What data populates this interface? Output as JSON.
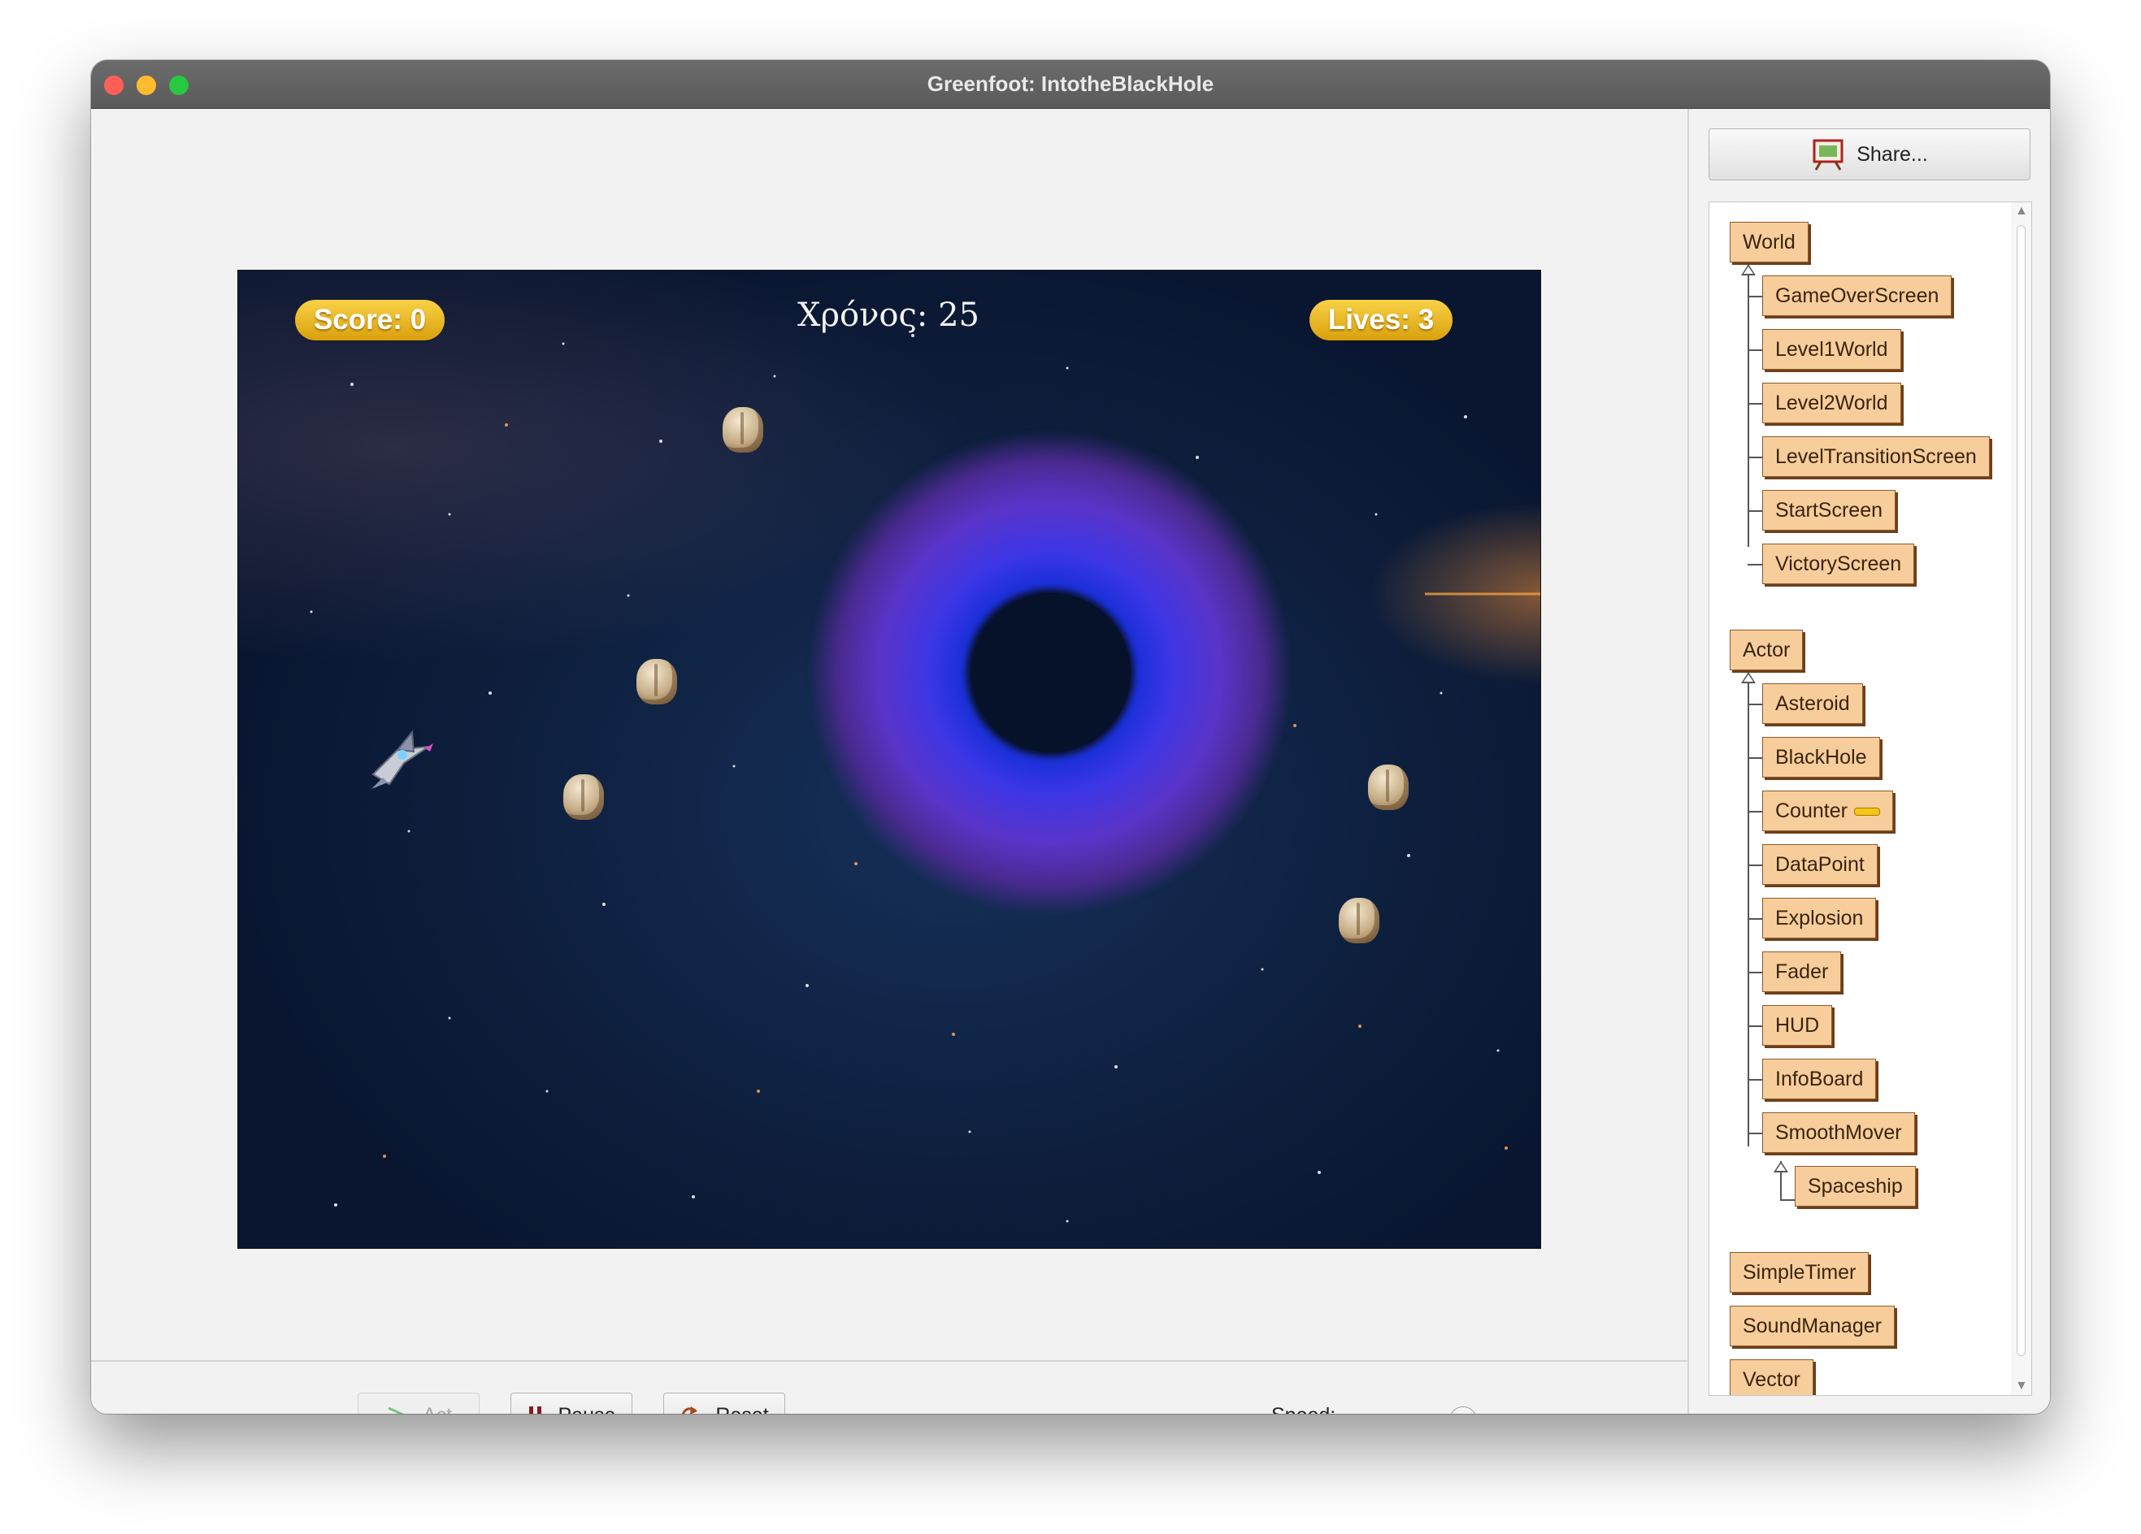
{
  "window": {
    "title": "Greenfoot: IntotheBlackHole"
  },
  "hud": {
    "score": "Score: 0",
    "timer": "Χρόνος: 25",
    "lives": "Lives: 3"
  },
  "controls": {
    "act_label": "Act",
    "pause_label": "Pause",
    "reset_label": "Reset",
    "speed_label": "Speed:",
    "speed_value": 0.5
  },
  "sidebar": {
    "share_label": "Share...",
    "classes": {
      "world": "World",
      "world_subclasses": [
        "GameOverScreen",
        "Level1World",
        "Level2World",
        "LevelTransitionScreen",
        "StartScreen",
        "VictoryScreen"
      ],
      "actor": "Actor",
      "actor_subclasses": [
        "Asteroid",
        "BlackHole",
        "Counter",
        "DataPoint",
        "Explosion",
        "Fader",
        "HUD",
        "InfoBoard",
        "SmoothMover"
      ],
      "smoothmover_subclass": "Spaceship",
      "other": [
        "SimpleTimer",
        "SoundManager",
        "Vector"
      ]
    }
  },
  "colors": {
    "class_box_fill": "#f7cd9b",
    "class_box_border": "#8b5a2b",
    "hud_pill": "#f0c22e",
    "space_background": "#0d1d3a",
    "blackhole_ring": "#3d36e6"
  },
  "icons": {
    "share": "share-easel-icon",
    "act": "play-chevron-icon",
    "pause": "pause-icon",
    "reset": "reset-icon"
  }
}
